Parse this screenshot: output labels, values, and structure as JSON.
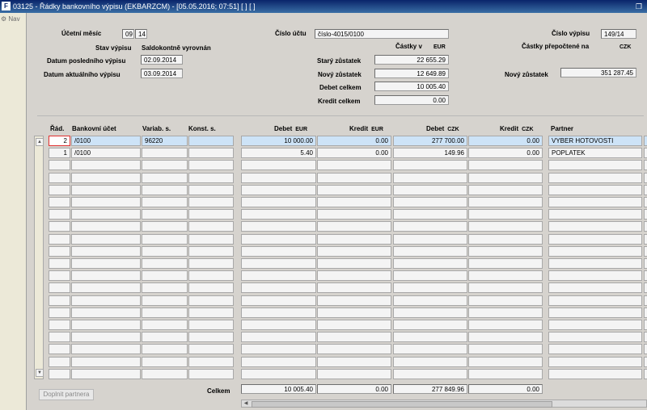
{
  "window": {
    "title": "03125 - Řádky bankovního výpisu (EKBARZCM) - [05.05.2016; 07:51]  [ ] [ ]",
    "app_icon": "F"
  },
  "nav": {
    "label": "Nav"
  },
  "header": {
    "ucetni_mesic_label": "Účetní měsíc",
    "ucetni_mesic_month": "09",
    "ucetni_mesic_year": "14",
    "cislo_uctu_label": "Číslo účtu",
    "cislo_uctu_value": "číslo-4015/0100",
    "cislo_vypisu_label": "Číslo výpisu",
    "cislo_vypisu_value": "149/14",
    "stav_label": "Stav výpisu",
    "stav_value": "Saldokontně vyrovnán",
    "castky_v_label": "Částky v",
    "castky_v_currency": "EUR",
    "prepoctene_label": "Částky přepočtené na",
    "prepoctene_currency": "CZK",
    "datum_posl_label": "Datum posledního výpisu",
    "datum_posl_value": "02.09.2014",
    "datum_akt_label": "Datum aktuálního výpisu",
    "datum_akt_value": "03.09.2014",
    "stary_label": "Starý zůstatek",
    "stary_value": "22 655.29",
    "novy_label": "Nový zůstatek",
    "novy_value": "12 649.89",
    "novy_czk_label": "Nový zůstatek",
    "novy_czk_value": "351 287.45",
    "debet_label": "Debet celkem",
    "debet_value": "10 005.40",
    "kredit_label": "Kredit celkem",
    "kredit_value": "0.00"
  },
  "columns": {
    "rad": "Řád.",
    "ucet": "Bankovní účet",
    "variab": "Variab. s.",
    "konst": "Konst. s.",
    "debet_eur": "Debet",
    "debet_eur_cur": "EUR",
    "kredit_eur": "Kredit",
    "kredit_eur_cur": "EUR",
    "debet_czk": "Debet",
    "debet_czk_cur": "CZK",
    "kredit_czk": "Kredit",
    "kredit_czk_cur": "CZK",
    "partner": "Partner"
  },
  "rows": [
    {
      "rad": "2",
      "ucet": "/0100",
      "variab": "96220",
      "konst": "",
      "debet_eur": "10 000.00",
      "kredit_eur": "0.00",
      "debet_czk": "277 700.00",
      "kredit_czk": "0.00",
      "partner": "VYBER HOTOVOSTI"
    },
    {
      "rad": "1",
      "ucet": "/0100",
      "variab": "",
      "konst": "",
      "debet_eur": "5.40",
      "kredit_eur": "0.00",
      "debet_czk": "149.96",
      "kredit_czk": "0.00",
      "partner": "POPLATEK"
    }
  ],
  "empty_rows": 18,
  "totals": {
    "label": "Celkem",
    "debet_eur": "10 005.40",
    "kredit_eur": "0.00",
    "debet_czk": "277 849.96",
    "kredit_czk": "0.00"
  },
  "buttons": {
    "doplnit_partnera": "Doplnit partnera"
  },
  "colors": {
    "titlebar": "#0a246a",
    "selected_row": "#cde3f7",
    "focus_border": "#e03030"
  }
}
